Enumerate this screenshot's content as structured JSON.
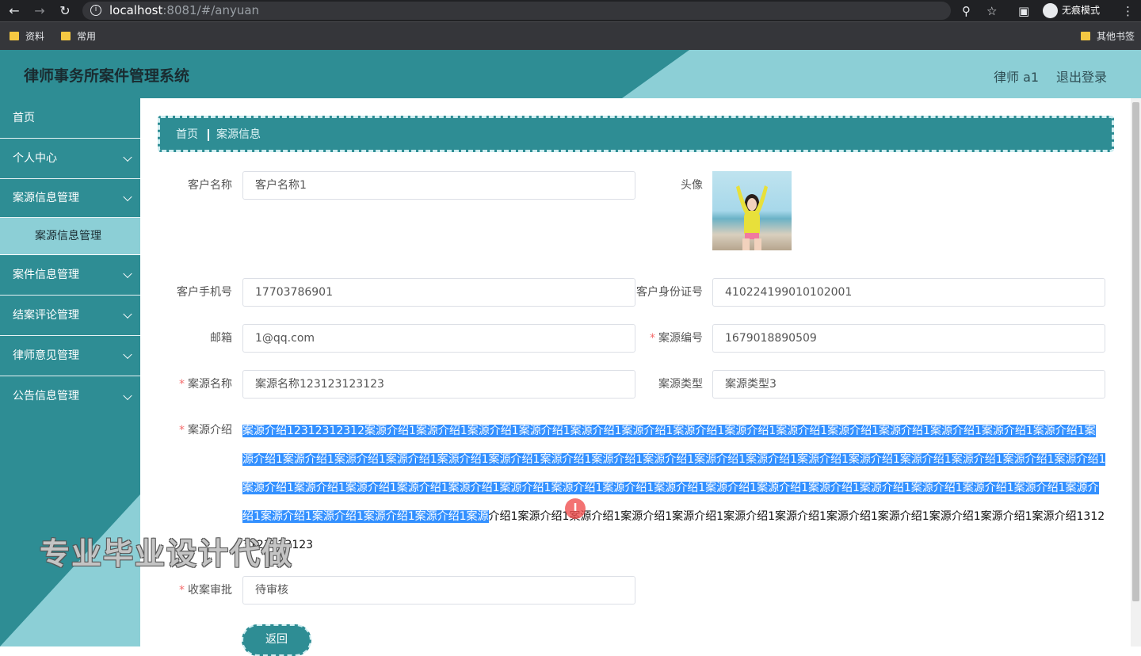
{
  "browser": {
    "url_host": "localhost",
    "url_path": ":8081/#/anyuan",
    "incognito_label": "无痕模式",
    "bookmarks": [
      "资料",
      "常用"
    ],
    "other_bookmarks": "其他书签"
  },
  "header": {
    "title": "律师事务所案件管理系统",
    "user": "律师 a1",
    "logout": "退出登录"
  },
  "sidebar": {
    "items": [
      {
        "label": "首页"
      },
      {
        "label": "个人中心"
      },
      {
        "label": "案源信息管理"
      },
      {
        "label": "案件信息管理"
      },
      {
        "label": "结案评论管理"
      },
      {
        "label": "律师意见管理"
      },
      {
        "label": "公告信息管理"
      }
    ],
    "sub_item": "案源信息管理"
  },
  "breadcrumb": {
    "home": "首页",
    "current": "案源信息"
  },
  "form": {
    "customer_name_label": "客户名称",
    "customer_name": "客户名称1",
    "avatar_label": "头像",
    "phone_label": "客户手机号",
    "phone": "17703786901",
    "id_label": "客户身份证号",
    "id_number": "410224199010102001",
    "email_label": "邮箱",
    "email": "1@qq.com",
    "case_no_label": "案源编号",
    "case_no": "1679018890509",
    "case_name_label": "案源名称",
    "case_name": "案源名称123123123123",
    "case_type_label": "案源类型",
    "case_type": "案源类型3",
    "intro_label": "案源介绍",
    "intro_selected": "案源介绍12312312312案源介绍1案源介绍1案源介绍1案源介绍1案源介绍1案源介绍1案源介绍1案源介绍1案源介绍1案源介绍1案源介绍1案源介绍1案源介绍1案源介绍1案源介绍1案源介绍1案源介绍1案源介绍1案源介绍1案源介绍1案源介绍1案源介绍1案源介绍1案源介绍1案源介绍1案源介绍1案源介绍1案源介绍1案源介绍1案源介绍1案源介绍1案源介绍1案源介绍1案源介绍1案源介绍1案源介绍1案源介绍1案源介绍1案源介绍1案源介绍1案源介绍1案源介绍1案源介绍1案源介绍1案源介绍1案源介绍1案源介绍1案源介绍1案源介绍1案源介绍1案源介绍1案源介绍1案源",
    "intro_rest": "介绍1案源介绍1案源介绍1案源介绍1案源介绍1案源介绍1案源介绍1案源介绍1案源介绍1案源介绍1案源介绍1案源介绍13123123123123",
    "approval_label": "收案审批",
    "approval": "待审核",
    "back_button": "返回"
  },
  "watermark": "专业毕业设计代做"
}
